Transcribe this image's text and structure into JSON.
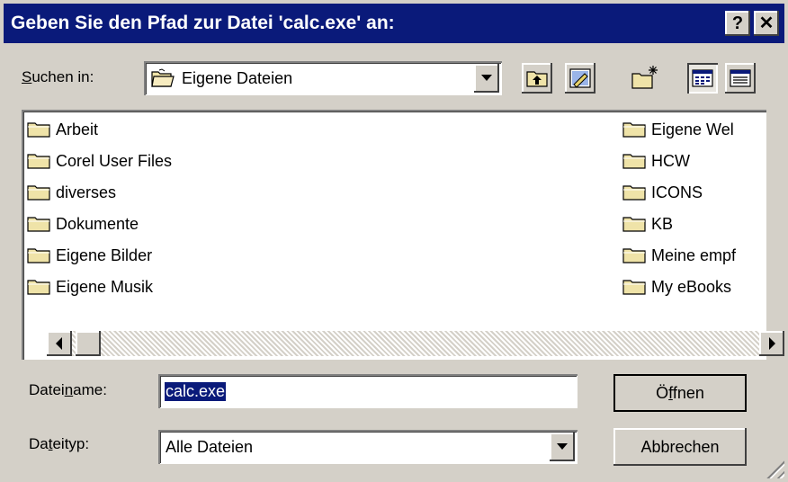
{
  "window": {
    "title": "Geben Sie den Pfad zur Datei 'calc.exe' an:",
    "help_glyph": "?",
    "close_glyph": "✕"
  },
  "look_in": {
    "label_u": "S",
    "label_rest": "uchen in:",
    "value": "Eigene Dateien"
  },
  "files": {
    "left_column": [
      "Arbeit",
      "Corel User Files",
      "diverses",
      "Dokumente",
      "Eigene Bilder",
      "Eigene Musik"
    ],
    "right_column": [
      "Eigene Wel",
      "HCW",
      "ICONS",
      "KB",
      "Meine empf",
      "My eBooks"
    ]
  },
  "filename": {
    "label_a": "Datei",
    "label_u": "n",
    "label_b": "ame:",
    "value": "calc.exe"
  },
  "filetype": {
    "label_a": "Da",
    "label_u": "t",
    "label_b": "eityp:",
    "value": "Alle Dateien"
  },
  "buttons": {
    "open_a": "Ö",
    "open_u": "f",
    "open_b": "fnen",
    "cancel": "Abbrechen"
  },
  "colors": {
    "titlebar": "#0a1a7a",
    "selection": "#0a1a7a",
    "folder": "#efe3a8"
  },
  "icons": [
    "folder-open-icon",
    "up-folder-icon",
    "desktop-icon",
    "new-folder-icon",
    "list-view-icon",
    "details-view-icon",
    "folder-icon"
  ]
}
